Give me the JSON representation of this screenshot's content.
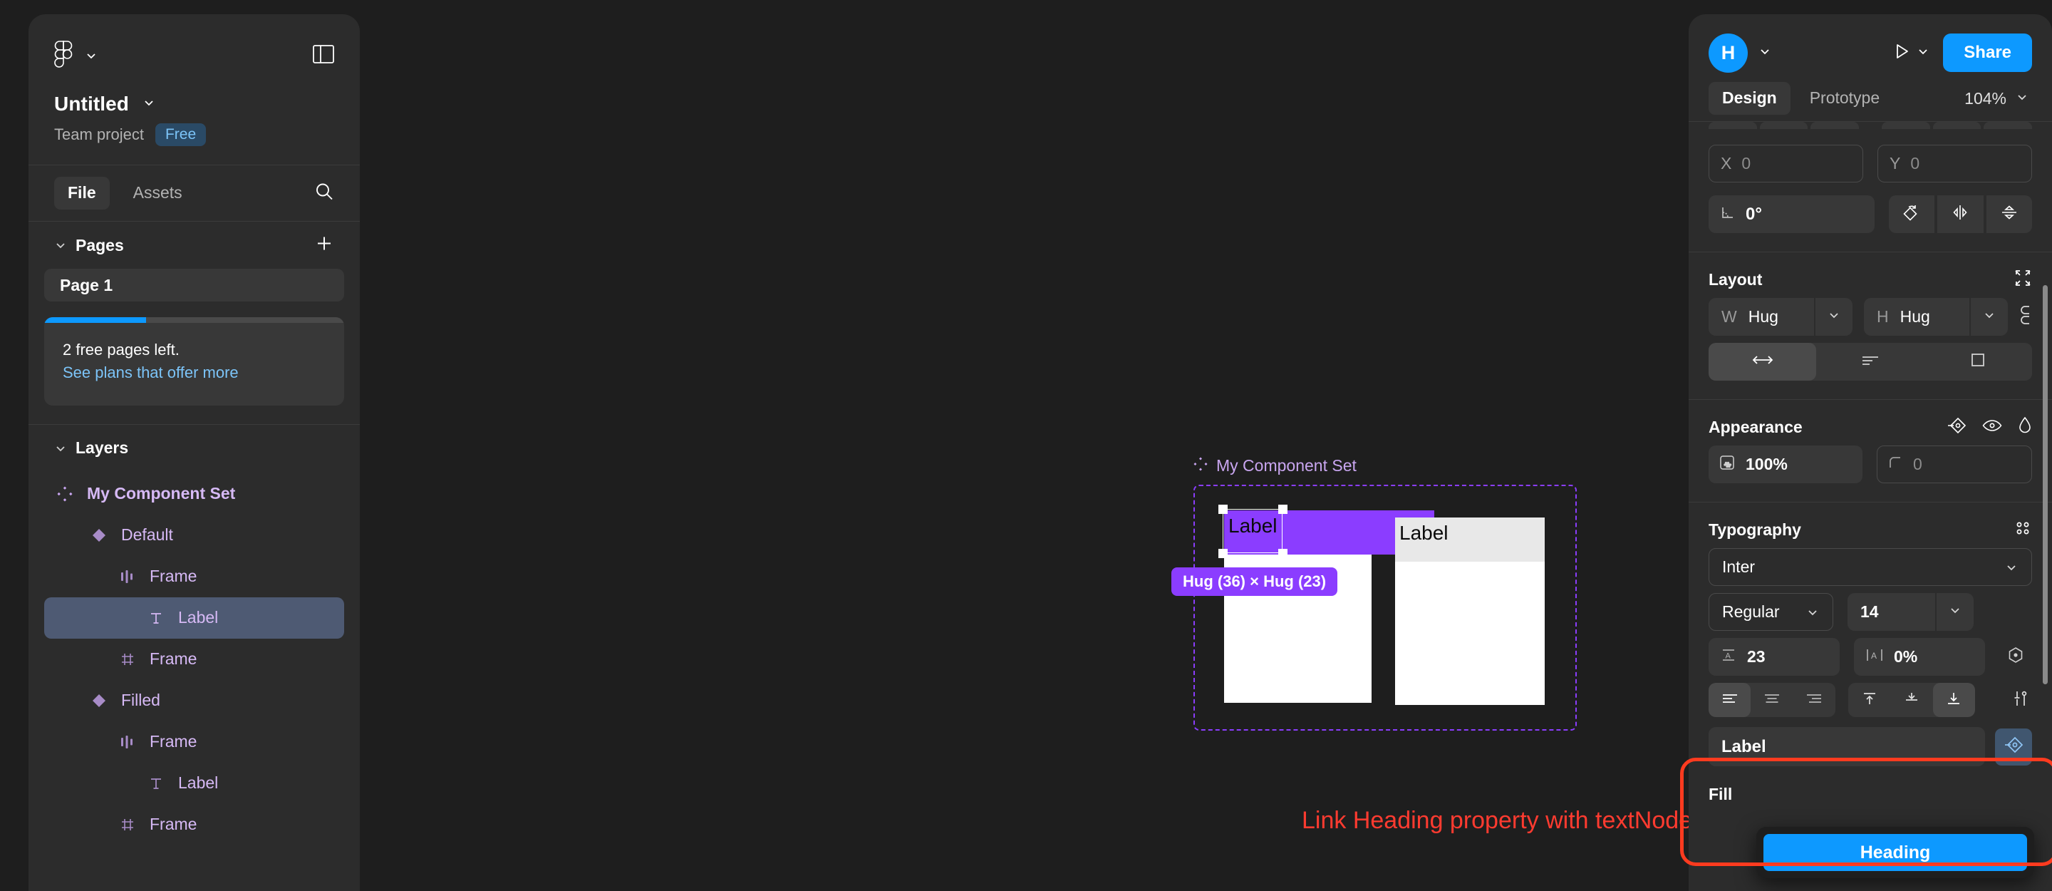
{
  "sidebar": {
    "logo_icon": "figma-logo-icon",
    "menu_caret_icon": "chevron-down-icon",
    "panel_toggle_icon": "panel-layout-icon",
    "file_name": "Untitled",
    "file_caret_icon": "chevron-down-icon",
    "team_project": "Team project",
    "plan_badge": "Free",
    "tabs": [
      {
        "label": "File",
        "active": true
      },
      {
        "label": "Assets",
        "active": false
      }
    ],
    "search_icon": "search-icon",
    "pages": {
      "section_label": "Pages",
      "caret_icon": "chevron-down-icon",
      "add_icon": "plus-icon",
      "items": [
        {
          "label": "Page 1",
          "selected": true
        }
      ]
    },
    "free_card": {
      "progress_percent": 34,
      "line1": "2 free pages left.",
      "line2": "See plans that offer more"
    },
    "layers": {
      "section_label": "Layers",
      "caret_icon": "chevron-down-icon",
      "items": [
        {
          "label": "My Component Set",
          "icon": "component-set-icon",
          "depth": 0,
          "bold": true,
          "selected": false
        },
        {
          "label": "Default",
          "icon": "component-icon",
          "depth": 1,
          "bold": false,
          "selected": false
        },
        {
          "label": "Frame",
          "icon": "auto-layout-horizontal-icon",
          "depth": 2,
          "bold": false,
          "selected": false
        },
        {
          "label": "Label",
          "icon": "text-icon",
          "depth": 3,
          "bold": false,
          "selected": true
        },
        {
          "label": "Frame",
          "icon": "frame-icon",
          "depth": 2,
          "bold": false,
          "selected": false
        },
        {
          "label": "Filled",
          "icon": "component-icon",
          "depth": 1,
          "bold": false,
          "selected": false
        },
        {
          "label": "Frame",
          "icon": "auto-layout-horizontal-icon",
          "depth": 2,
          "bold": false,
          "selected": false
        },
        {
          "label": "Label",
          "icon": "text-icon",
          "depth": 3,
          "bold": false,
          "selected": false
        },
        {
          "label": "Frame",
          "icon": "frame-icon",
          "depth": 2,
          "bold": false,
          "selected": false
        }
      ]
    }
  },
  "canvas": {
    "component_set_title": "My Component Set",
    "component_set_icon": "component-set-icon",
    "variant_default_label": "Label",
    "variant_filled_label": "Label",
    "selection_dimension_pill": "Hug (36) × Hug (23)",
    "annotation": "Link Heading property with textNode programmatically",
    "annotation_color": "#ff3b30",
    "selection_color": "#8b3dff"
  },
  "right_panel": {
    "avatar_initial": "H",
    "avatar_caret_icon": "chevron-down-icon",
    "present_icon": "play-icon",
    "present_caret_icon": "chevron-down-icon",
    "share_label": "Share",
    "tabs": [
      {
        "label": "Design",
        "active": true
      },
      {
        "label": "Prototype",
        "active": false
      }
    ],
    "zoom_level": "104%",
    "zoom_caret_icon": "chevron-down-icon",
    "position": {
      "x_key": "X",
      "x_value": "0",
      "y_key": "Y",
      "y_value": "0",
      "rotation_icon": "angle-icon",
      "rotation_value": "0°",
      "rotate_icon": "rotate-icon",
      "flip_h_icon": "flip-horizontal-icon",
      "flip_v_icon": "flip-vertical-icon"
    },
    "layout": {
      "title": "Layout",
      "collapse_icon": "collapse-icon",
      "w_key": "W",
      "w_value": "Hug",
      "w_caret_icon": "chevron-down-icon",
      "h_key": "H",
      "h_value": "Hug",
      "h_caret_icon": "chevron-down-icon",
      "link_icon": "link-sizes-icon",
      "segments": [
        {
          "icon": "resize-horizontal-icon",
          "active": true
        },
        {
          "icon": "text-align-left-icon",
          "active": false
        },
        {
          "icon": "square-icon",
          "active": false
        }
      ]
    },
    "appearance": {
      "title": "Appearance",
      "tools": [
        "apply-style-icon",
        "visibility-icon",
        "blend-mode-icon"
      ],
      "opacity_icon": "opacity-icon",
      "opacity_value": "100%",
      "corner_icon": "corner-radius-icon",
      "corner_value": "0"
    },
    "typography": {
      "title": "Typography",
      "tools": [
        "type-settings-icon"
      ],
      "font_family": "Inter",
      "font_family_caret_icon": "chevron-down-icon",
      "font_weight": "Regular",
      "font_weight_caret_icon": "chevron-down-icon",
      "font_size": "14",
      "font_size_caret_icon": "chevron-down-icon",
      "line_height_icon": "line-height-icon",
      "line_height": "23",
      "letter_spacing_icon": "letter-spacing-icon",
      "letter_spacing": "0%",
      "type_detail_icon": "type-detail-icon",
      "h_align": [
        {
          "icon": "align-left-icon",
          "active": true
        },
        {
          "icon": "align-center-icon",
          "active": false
        },
        {
          "icon": "align-right-icon",
          "active": false
        }
      ],
      "v_align": [
        {
          "icon": "align-top-icon",
          "active": false
        },
        {
          "icon": "align-middle-icon",
          "active": false
        },
        {
          "icon": "align-bottom-icon",
          "active": true
        }
      ],
      "more_icon": "type-options-icon"
    },
    "content_property": {
      "value": "Label",
      "apply_property_icon": "apply-property-icon",
      "highlighted": true
    },
    "property_dropdown": {
      "options": [
        {
          "label": "Heading",
          "selected": true
        }
      ]
    },
    "fill": {
      "title": "Fill"
    }
  },
  "colors": {
    "accent_blue": "#0d99ff",
    "purple": "#8b3dff",
    "panel_bg": "#2c2c2c",
    "canvas_bg": "#1e1e1e",
    "highlight_red": "#ff3b1f",
    "layer_text": "#d6b9f5"
  }
}
